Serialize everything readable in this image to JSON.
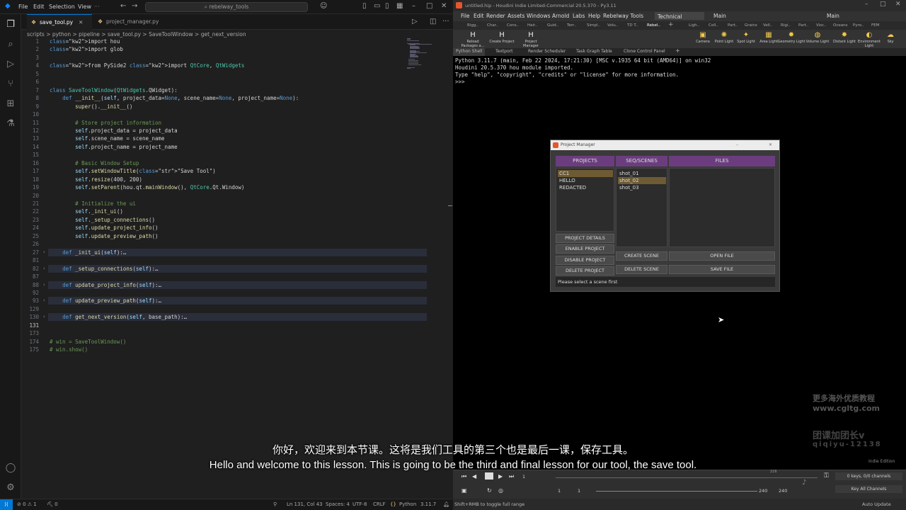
{
  "vscode": {
    "menu": [
      "File",
      "Edit",
      "Selection",
      "View"
    ],
    "search": "rebelway_tools",
    "tabs": [
      {
        "label": "save_tool.py",
        "active": true
      },
      {
        "label": "project_manager.py",
        "active": false
      }
    ],
    "breadcrumb": "scripts > python > pipeline > save_tool.py > SaveToolWindow > get_next_version",
    "lines": [
      {
        "n": "1",
        "t": "import hou"
      },
      {
        "n": "2",
        "t": "import glob"
      },
      {
        "n": "3",
        "t": ""
      },
      {
        "n": "4",
        "t": "from PySide2 import QtCore, QtWidgets"
      },
      {
        "n": "5",
        "t": ""
      },
      {
        "n": "6",
        "t": ""
      },
      {
        "n": "7",
        "t": "class SaveToolWindow(QtWidgets.QWidget):"
      },
      {
        "n": "8",
        "t": "    def __init__(self, project_data=None, scene_name=None, project_name=None):"
      },
      {
        "n": "9",
        "t": "        super().__init__()"
      },
      {
        "n": "10",
        "t": ""
      },
      {
        "n": "11",
        "t": "        # Store project information"
      },
      {
        "n": "12",
        "t": "        self.project_data = project_data"
      },
      {
        "n": "13",
        "t": "        self.scene_name = scene_name"
      },
      {
        "n": "14",
        "t": "        self.project_name = project_name"
      },
      {
        "n": "15",
        "t": ""
      },
      {
        "n": "16",
        "t": "        # Basic Window Setup"
      },
      {
        "n": "17",
        "t": "        self.setWindowTitle(\"Save Tool\")"
      },
      {
        "n": "18",
        "t": "        self.resize(400, 200)"
      },
      {
        "n": "19",
        "t": "        self.setParent(hou.qt.mainWindow(), QtCore.Qt.Window)"
      },
      {
        "n": "20",
        "t": ""
      },
      {
        "n": "21",
        "t": "        # Initialize the ui"
      },
      {
        "n": "22",
        "t": "        self._init_ui()"
      },
      {
        "n": "23",
        "t": "        self._setup_connections()"
      },
      {
        "n": "24",
        "t": "        self.update_project_info()"
      },
      {
        "n": "25",
        "t": "        self.update_preview_path()"
      },
      {
        "n": "26",
        "t": ""
      },
      {
        "n": "27",
        "t": "    def _init_ui(self):…"
      },
      {
        "n": "81",
        "t": ""
      },
      {
        "n": "82",
        "t": "    def _setup_connections(self):…"
      },
      {
        "n": "87",
        "t": ""
      },
      {
        "n": "88",
        "t": "    def update_project_info(self):…"
      },
      {
        "n": "92",
        "t": ""
      },
      {
        "n": "93",
        "t": "    def update_preview_path(self):…"
      },
      {
        "n": "129",
        "t": ""
      },
      {
        "n": "130",
        "t": "    def get_next_version(self, base_path):…"
      },
      {
        "n": "131",
        "t": ""
      },
      {
        "n": "173",
        "t": ""
      },
      {
        "n": "174",
        "t": "# win = SaveToolWindow()"
      },
      {
        "n": "175",
        "t": "# win.show()"
      }
    ],
    "status": {
      "errors": "⊘ 0 ⚠ 1",
      "ports": "⛏ 0",
      "pos": "Ln 131, Col 43",
      "spaces": "Spaces: 4",
      "enc": "UTF-8",
      "eol": "CRLF",
      "lang": "Python",
      "ver": "3.11.7"
    }
  },
  "houdini": {
    "title": "untitled.hip - Houdini Indie Limited-Commercial 20.5.370 - Py3.11",
    "menu": [
      "File",
      "Edit",
      "Render",
      "Assets",
      "Windows",
      "Arnold",
      "Labs",
      "Help",
      "Rebelway Tools"
    ],
    "desktop": "Technical",
    "main1": "Main",
    "main2": "Main",
    "shelf_tools": [
      {
        "label": "Reload Packages a...",
        "icon": "H"
      },
      {
        "label": "Create Project",
        "icon": "H"
      },
      {
        "label": "Project Manager",
        "icon": "H"
      }
    ],
    "light_tools": [
      "Camera",
      "Point Light",
      "Spot Light",
      "Area Light",
      "Geometry Light",
      "Volume Light",
      "Distant Light",
      "Environment Light",
      "Sky"
    ],
    "pane_tabs": [
      "Python Shell",
      "Textport",
      "Render Scheduler",
      "Task Graph Table",
      "Clone Control Panel"
    ],
    "console": "Python 3.11.7 (main, Feb 22 2024, 17:21:30) [MSC v.1935 64 bit (AMD64)] on win32\nHoudini 20.5.370 hou module imported.\nType \"help\", \"copyright\", \"credits\" or \"license\" for more information.\n>>> ",
    "pm": {
      "title": "Project Manager",
      "headers": [
        "PROJECTS",
        "SEQ/SCENES",
        "FILES"
      ],
      "projects": [
        "CC1",
        "HELLO",
        "REDACTED"
      ],
      "scenes": [
        "shot_01",
        "shot_02",
        "shot_03"
      ],
      "buttons": {
        "details": "PROJECT DETAILS",
        "enable": "ENABLE PROJECT",
        "disable": "DISABLE PROJECT",
        "delete": "DELETE PROJECT",
        "create_scene": "CREATE SCENE",
        "delete_scene": "DELETE SCENE",
        "open_file": "OPEN FILE",
        "save_file": "SAVE FILE"
      },
      "status": "Please select a scene first"
    },
    "timeline": {
      "frame": "1",
      "start": "1",
      "start2": "1",
      "end": "240",
      "end2": "240",
      "keys": "0 keys, 0/0 channels",
      "keyall": "Key All Channels",
      "ruler_end": "216",
      "indie": "Indie Edition"
    },
    "hint": "Shift+RMB to toggle full range",
    "autoupdate": "Auto Update"
  },
  "watermark": {
    "l1": "更多海外优质教程",
    "l2": "www.cgltg.com",
    "l3": "团课加团长v",
    "l4": "qiqiyu-12138"
  },
  "subtitles": {
    "zh": "你好，欢迎来到本节课。这将是我们工具的第三个也是最后一课，保存工具。",
    "en": "Hello and welcome to this lesson. This is going to be the third and final lesson for our tool, the save tool."
  }
}
